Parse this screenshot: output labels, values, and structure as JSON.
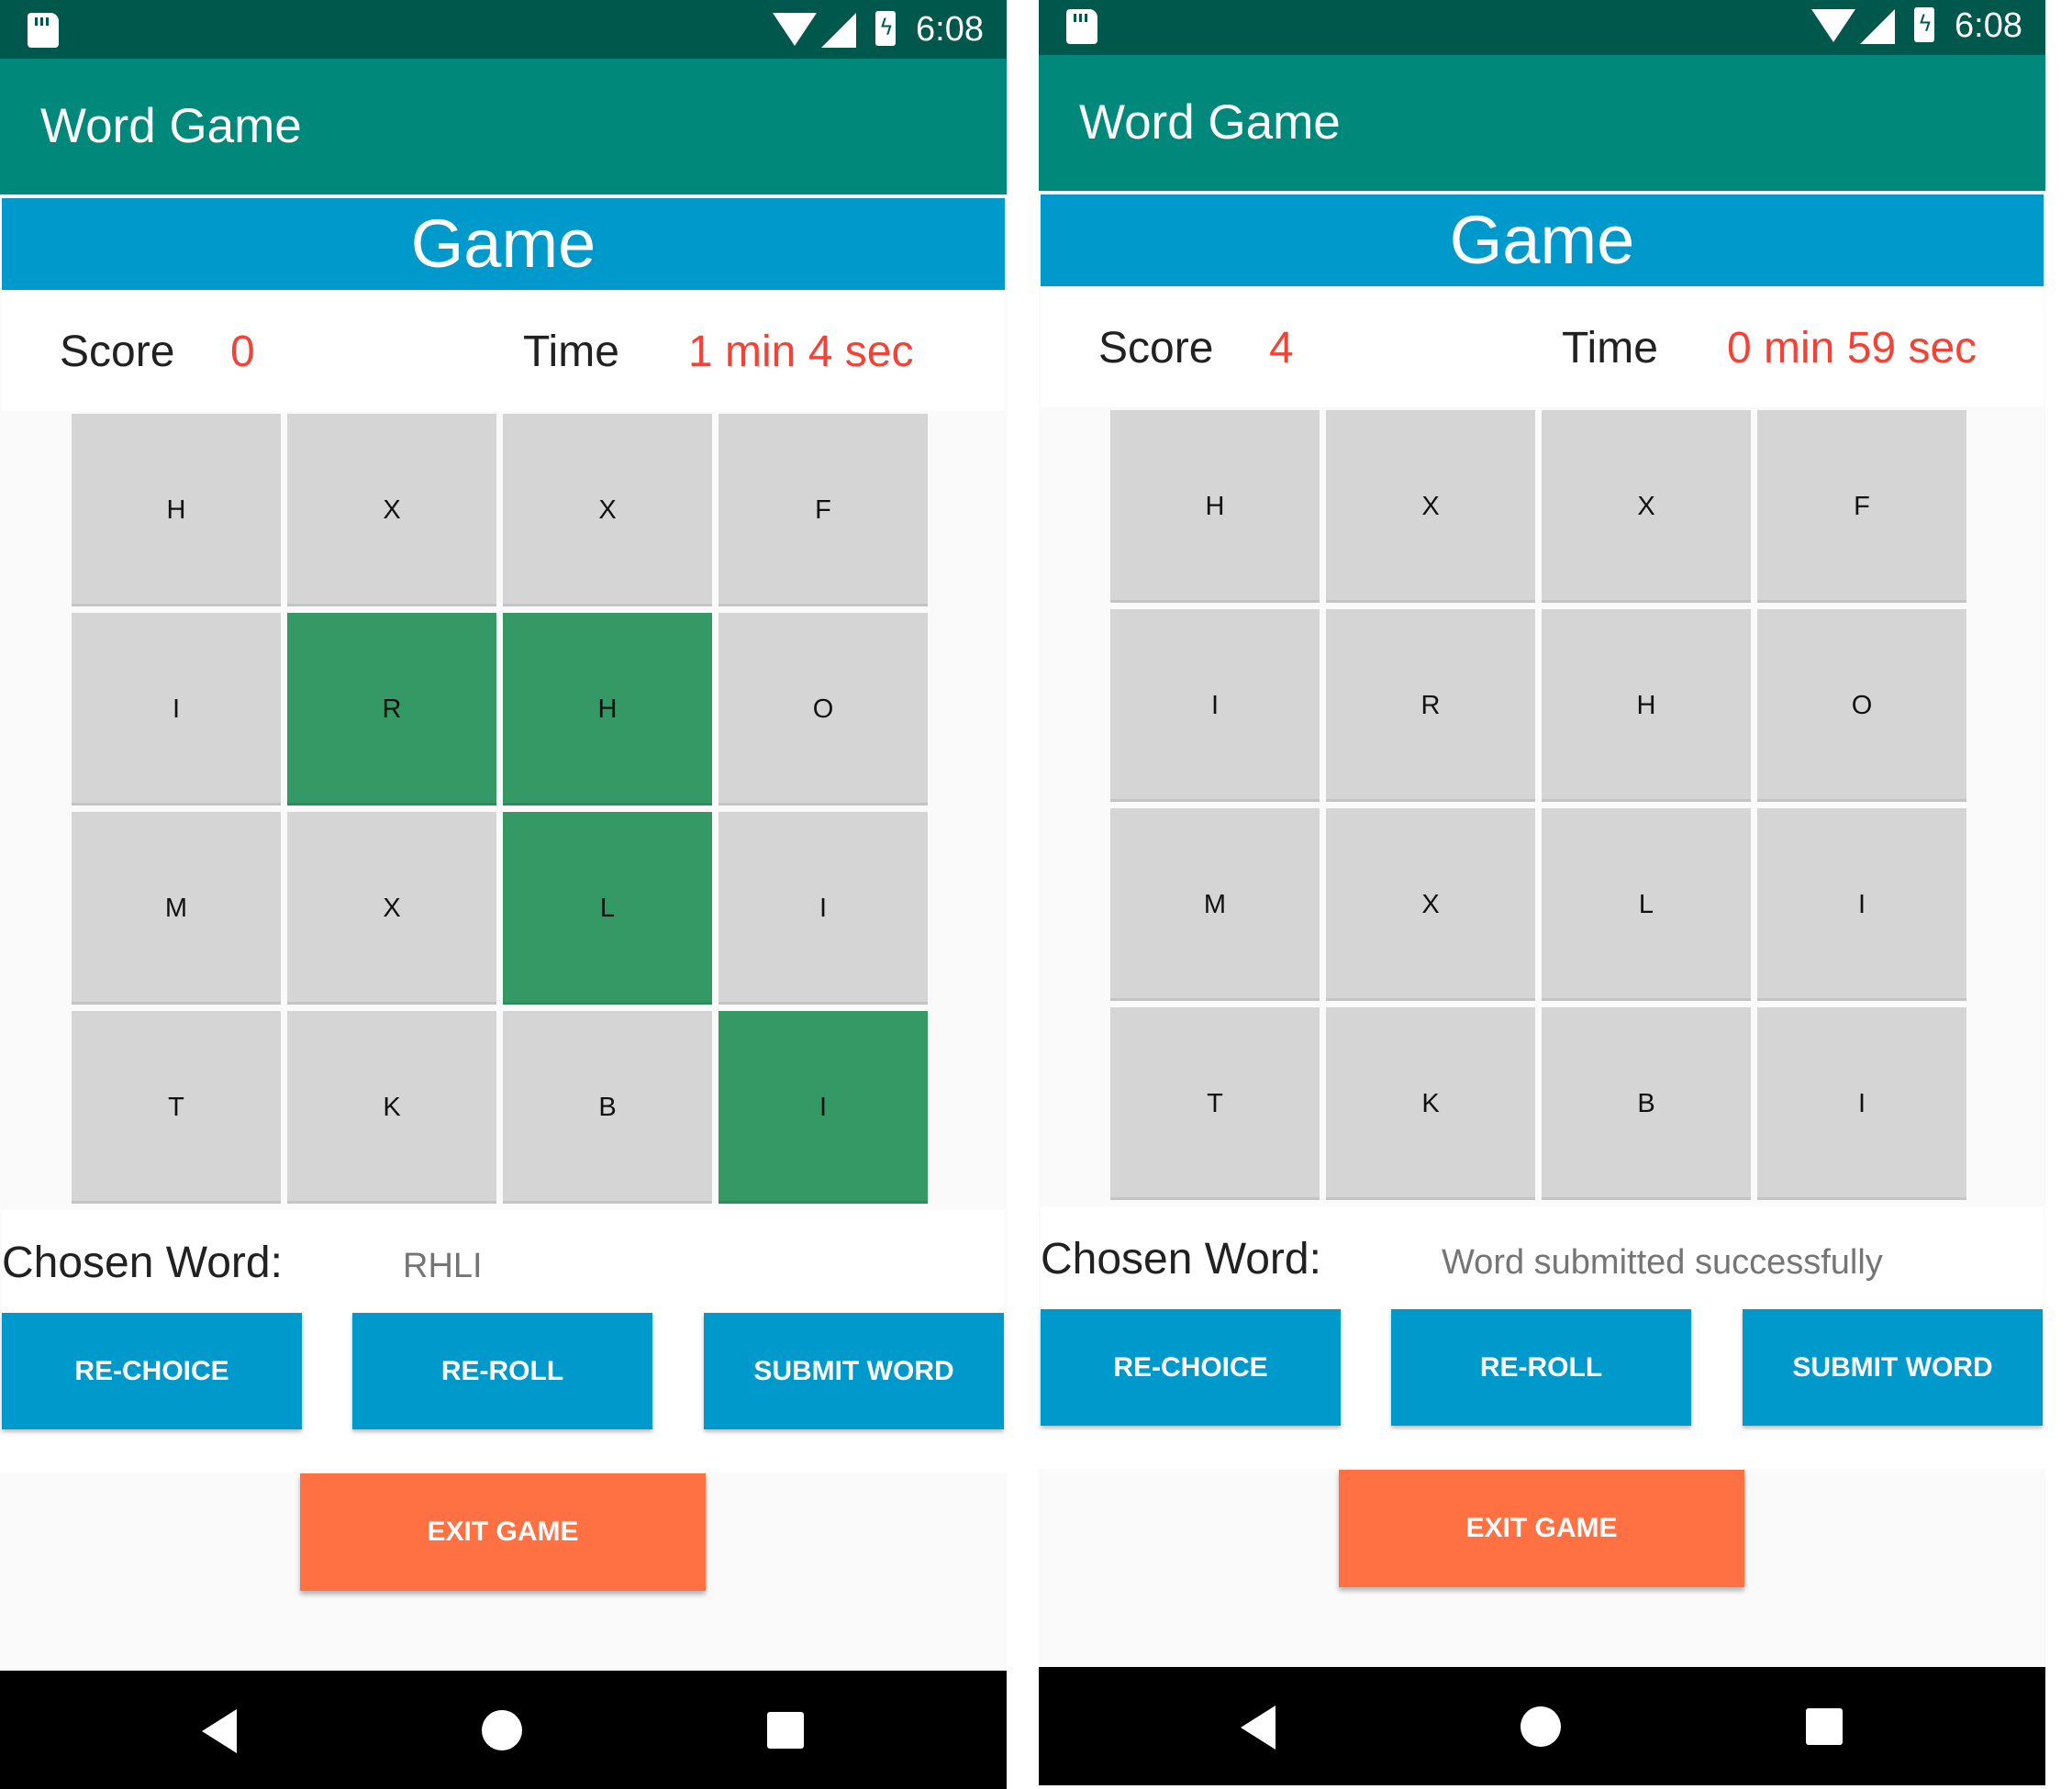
{
  "status": {
    "time": "6:08"
  },
  "app": {
    "title": "Word Game"
  },
  "labels": {
    "game_header": "Game",
    "score": "Score",
    "time": "Time",
    "chosen_word": "Chosen Word:",
    "re_choice": "RE-CHOICE",
    "re_roll": "RE-ROLL",
    "submit_word": "SUBMIT WORD",
    "exit_game": "EXIT GAME"
  },
  "colors": {
    "statusbar": "#00574b",
    "appbar": "#00897b",
    "accent_blue": "#0099cc",
    "tile_default": "#d5d5d5",
    "tile_selected": "#359966",
    "value_red": "#f44336",
    "exit_orange": "#ff7043"
  },
  "icons": [
    "sd-card-icon",
    "wifi-icon",
    "signal-icon",
    "battery-charging-icon",
    "back-icon",
    "home-icon",
    "recents-icon"
  ],
  "screens": [
    {
      "score": "0",
      "time": "1 min 4 sec",
      "chosen_word": "RHLI",
      "grid": [
        [
          "H",
          "X",
          "X",
          "F"
        ],
        [
          "I",
          "R",
          "H",
          "O"
        ],
        [
          "M",
          "X",
          "L",
          "I"
        ],
        [
          "T",
          "K",
          "B",
          "I"
        ]
      ],
      "selected": [
        [
          1,
          1
        ],
        [
          1,
          2
        ],
        [
          2,
          2
        ],
        [
          3,
          3
        ]
      ]
    },
    {
      "score": "4",
      "time": "0 min 59 sec",
      "chosen_word": "Word submitted successfully",
      "grid": [
        [
          "H",
          "X",
          "X",
          "F"
        ],
        [
          "I",
          "R",
          "H",
          "O"
        ],
        [
          "M",
          "X",
          "L",
          "I"
        ],
        [
          "T",
          "K",
          "B",
          "I"
        ]
      ],
      "selected": []
    }
  ]
}
